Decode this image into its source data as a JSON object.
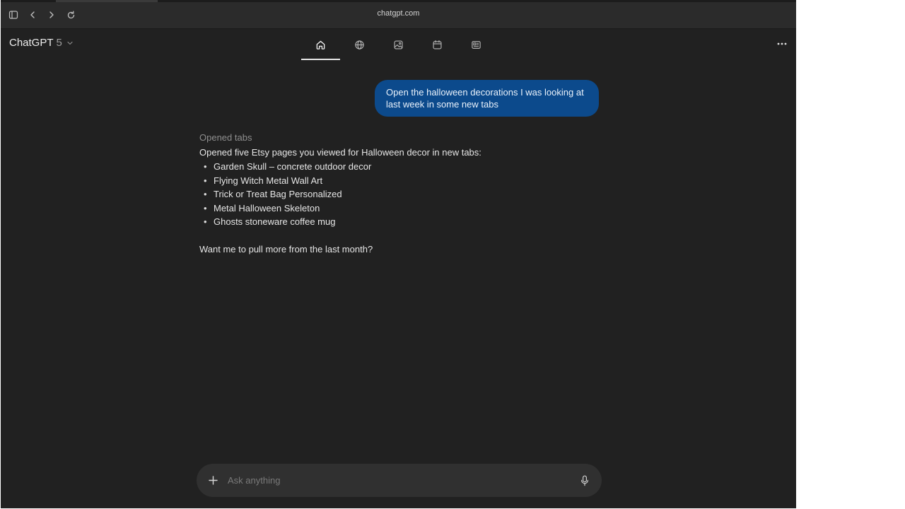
{
  "browser": {
    "address": "chatgpt.com",
    "icons": [
      "sidebar-icon",
      "back-icon",
      "forward-icon",
      "reload-icon"
    ]
  },
  "header": {
    "model_name": "ChatGPT",
    "model_version": "5",
    "tabs": [
      {
        "icon": "home-icon",
        "active": true
      },
      {
        "icon": "globe-icon",
        "active": false
      },
      {
        "icon": "image-icon",
        "active": false
      },
      {
        "icon": "calendar-icon",
        "active": false
      },
      {
        "icon": "news-icon",
        "active": false
      }
    ],
    "more_icon": "more-horizontal-icon"
  },
  "conversation": {
    "user_message": "Open the halloween decorations I was looking at last week in some new tabs",
    "assistant": {
      "status": "Opened tabs",
      "intro": "Opened five Etsy pages you viewed for Halloween decor in new tabs:",
      "items": [
        "Garden Skull – concrete outdoor decor",
        "Flying Witch Metal Wall Art",
        "Trick or Treat Bag Personalized",
        "Metal Halloween Skeleton",
        "Ghosts stoneware coffee mug"
      ],
      "followup": "Want me to pull more from the last month?"
    }
  },
  "composer": {
    "placeholder": "Ask anything",
    "value": ""
  },
  "colors": {
    "background": "#212121",
    "user_bubble": "#0c4a8c",
    "composer": "#303030"
  }
}
